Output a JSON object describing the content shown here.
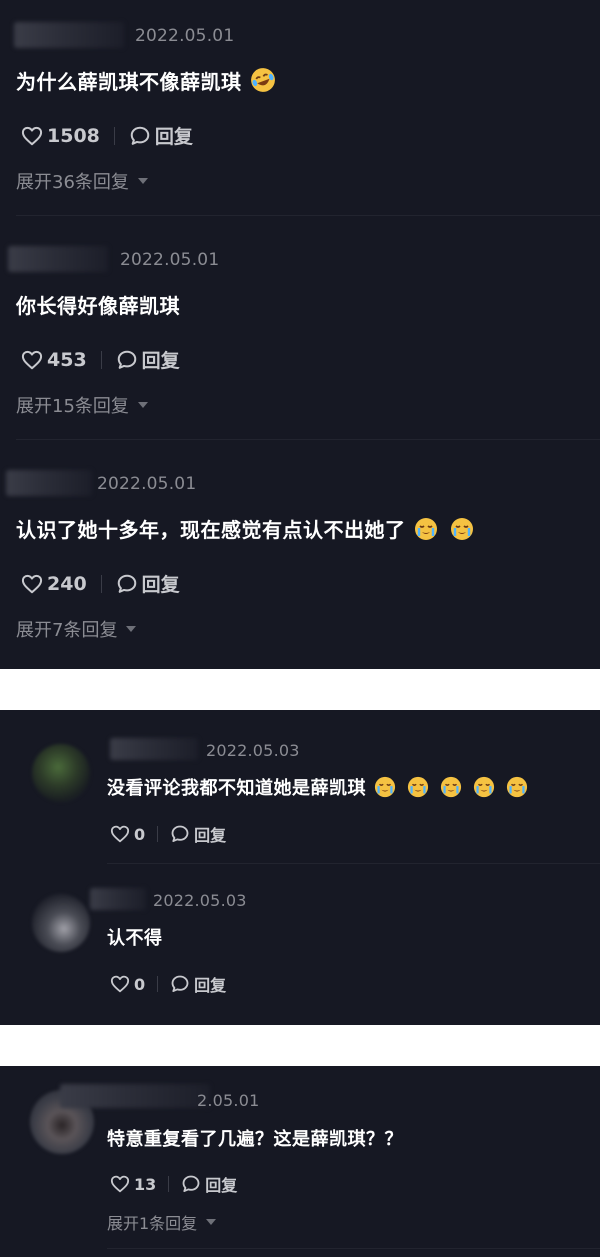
{
  "panel1": {
    "comments": [
      {
        "date": "2022.05.01",
        "text": "为什么薛凯琪不像薛凯琪",
        "likes": "1508",
        "reply_label": "回复",
        "expand_label": "展开36条回复",
        "emoji": "laugh-cry"
      },
      {
        "date": "2022.05.01",
        "text": "你长得好像薛凯琪",
        "likes": "453",
        "reply_label": "回复",
        "expand_label": "展开15条回复"
      },
      {
        "date": "2022.05.01",
        "text": "认识了她十多年，现在感觉有点认不出她了",
        "likes": "240",
        "reply_label": "回复",
        "expand_label": "展开7条回复",
        "emoji": "crying"
      }
    ]
  },
  "panel2": {
    "replies": [
      {
        "date": "2022.05.03",
        "text": "没看评论我都不知道她是薛凯琪",
        "likes": "0",
        "reply_label": "回复",
        "emoji": "crying"
      },
      {
        "date": "2022.05.03",
        "text": "认不得",
        "likes": "0",
        "reply_label": "回复"
      }
    ]
  },
  "panel3": {
    "replies": [
      {
        "date": "2.05.01",
        "text": "特意重复看了几遍？这是薛凯琪？？",
        "likes": "13",
        "reply_label": "回复",
        "expand_label": "展开1条回复"
      }
    ]
  },
  "colors": {
    "background": "#161823",
    "text": "#ffffff",
    "muted": "#8b8c93",
    "emoji_face": "#f5c242"
  }
}
